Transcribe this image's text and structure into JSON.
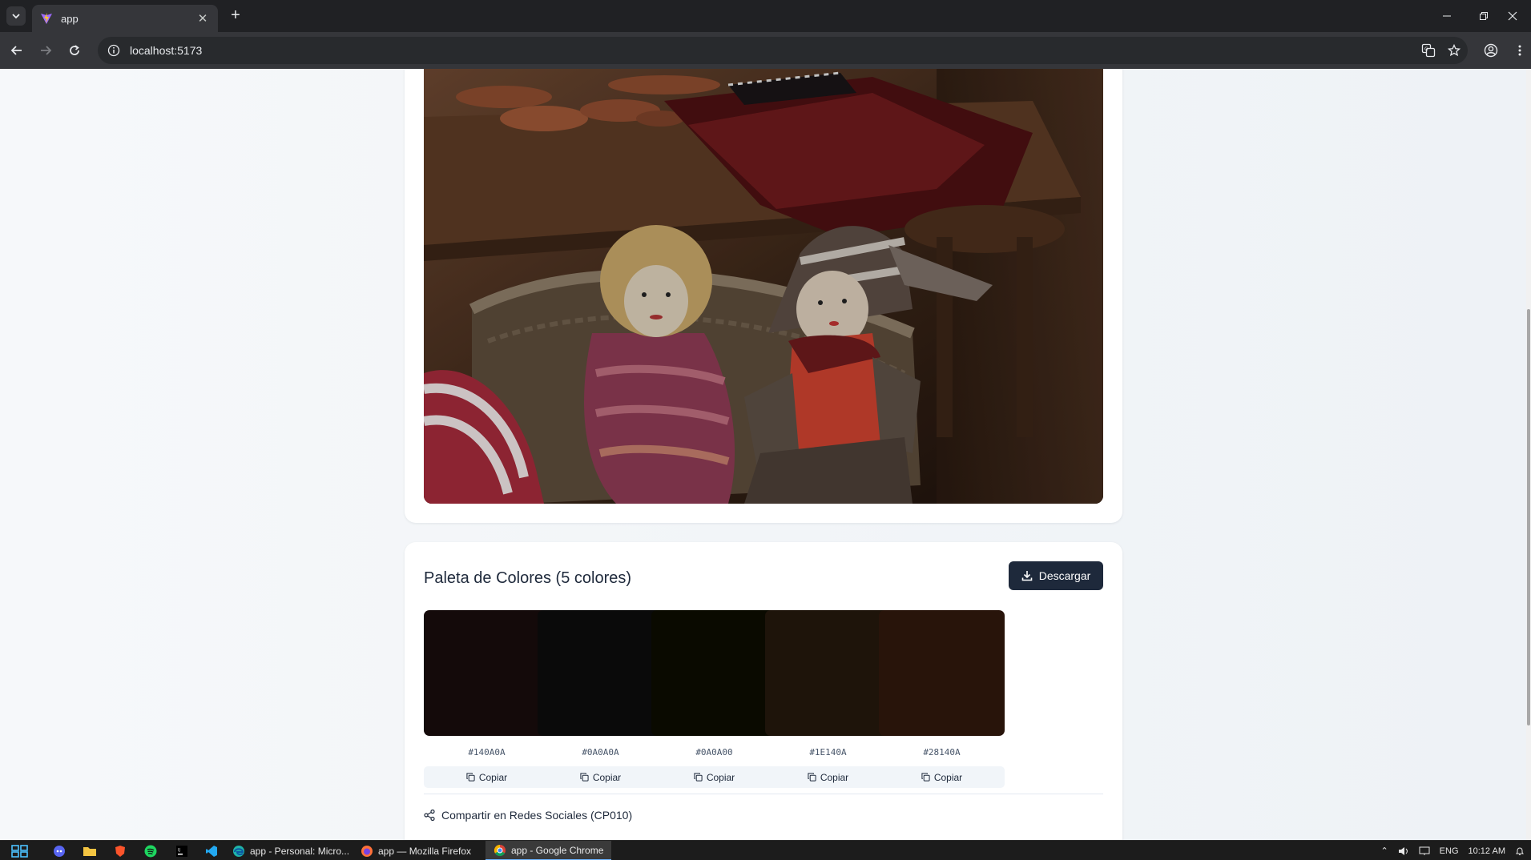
{
  "browser": {
    "tab_title": "app",
    "url": "localhost:5173"
  },
  "palette": {
    "title": "Paleta de Colores (5 colores)",
    "download_label": "Descargar",
    "colors": [
      {
        "hex": "#140A0A",
        "copy_label": "Copiar"
      },
      {
        "hex": "#0A0A0A",
        "copy_label": "Copiar"
      },
      {
        "hex": "#0A0A00",
        "copy_label": "Copiar"
      },
      {
        "hex": "#1E140A",
        "copy_label": "Copiar"
      },
      {
        "hex": "#28140A",
        "copy_label": "Copiar"
      }
    ],
    "share_label": "Compartir en Redes Sociales (CP010)"
  },
  "taskbar": {
    "items": [
      {
        "label": "app - Personal: Micro...",
        "icon": "edge-icon"
      },
      {
        "label": "app — Mozilla Firefox",
        "icon": "firefox-icon"
      },
      {
        "label": "app - Google Chrome",
        "icon": "chrome-icon"
      }
    ],
    "language": "ENG",
    "time": "10:12 AM"
  },
  "colors": {
    "primary_button": "#1e293b",
    "browser_frame": "#202124"
  }
}
